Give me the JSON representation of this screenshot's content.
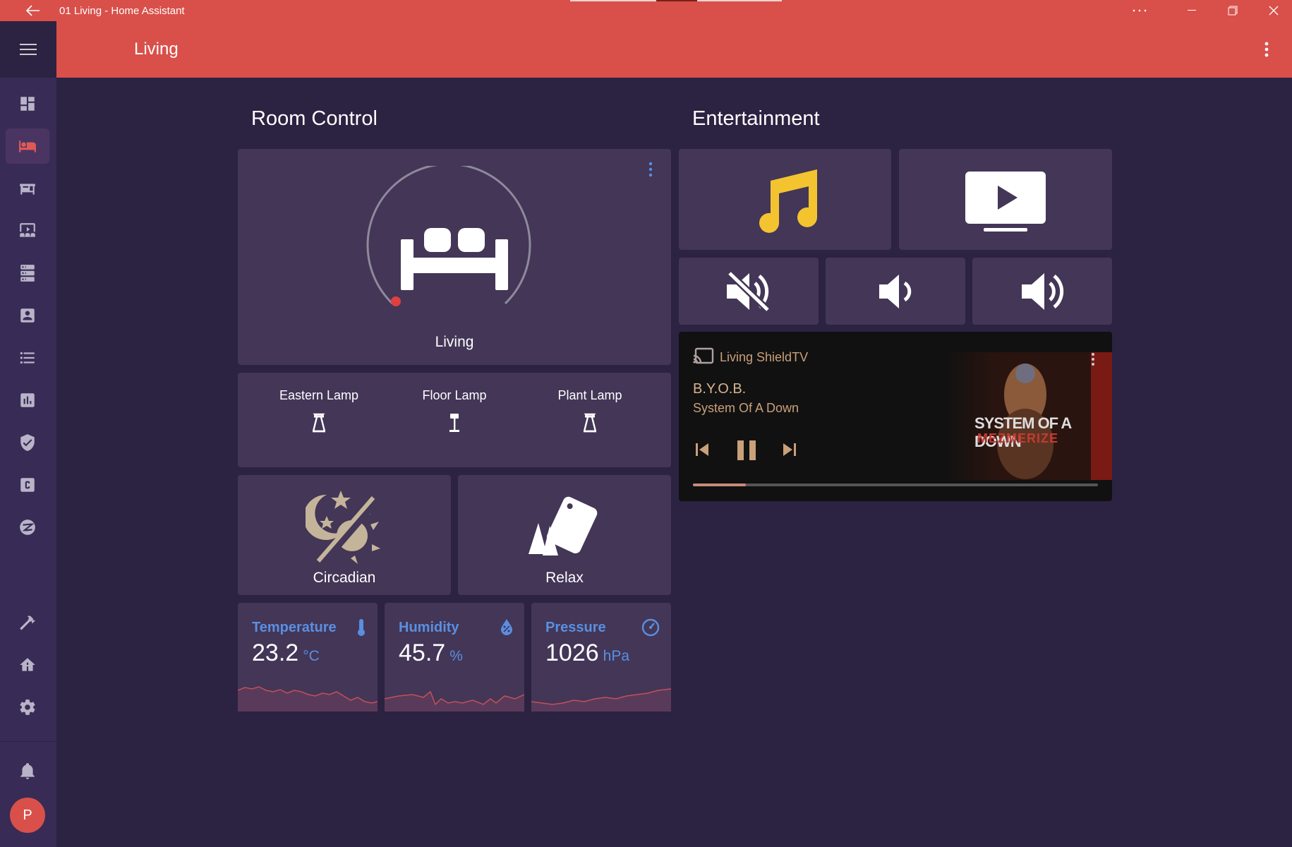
{
  "window": {
    "title": "01 Living - Home Assistant"
  },
  "header": {
    "title": "Living"
  },
  "sidebar": {
    "items": [
      {
        "icon": "view-dashboard-icon"
      },
      {
        "icon": "sofa-icon",
        "active": true
      },
      {
        "icon": "desk-icon"
      },
      {
        "icon": "theater-icon"
      },
      {
        "icon": "server-icon"
      },
      {
        "icon": "account-box-icon"
      },
      {
        "icon": "format-list-icon"
      },
      {
        "icon": "chart-bar-icon"
      },
      {
        "icon": "shield-check-icon"
      },
      {
        "icon": "alpha-c-box-icon"
      },
      {
        "icon": "zigbee-icon"
      }
    ],
    "bottom_items": [
      {
        "icon": "hammer-icon"
      },
      {
        "icon": "home-tree-icon"
      },
      {
        "icon": "cog-icon"
      }
    ],
    "avatar_initial": "P"
  },
  "room_control": {
    "title": "Room Control",
    "hero": {
      "label": "Living",
      "icon": "sofa-icon"
    },
    "lamps": [
      {
        "label": "Eastern Lamp",
        "icon": "lamp-icon"
      },
      {
        "label": "Floor Lamp",
        "icon": "floor-lamp-icon"
      },
      {
        "label": "Plant Lamp",
        "icon": "lamp-icon"
      }
    ],
    "scenes": [
      {
        "label": "Circadian",
        "icon": "theme-light-dark-icon"
      },
      {
        "label": "Relax",
        "icon": "cards-icon"
      }
    ],
    "sensors": [
      {
        "name": "Temperature",
        "value": "23.2",
        "unit": "°C",
        "icon": "thermometer-icon"
      },
      {
        "name": "Humidity",
        "value": "45.7",
        "unit": "%",
        "icon": "water-percent-icon"
      },
      {
        "name": "Pressure",
        "value": "1026",
        "unit": "hPa",
        "icon": "gauge-icon"
      }
    ]
  },
  "entertainment": {
    "title": "Entertainment",
    "media_player": {
      "source": "Living ShieldTV",
      "title": "B.Y.O.B.",
      "artist": "System Of A Down",
      "album_art_text_1": "SYSTEM OF A DOWN",
      "album_art_text_2": "MEZMERIZE",
      "progress": 0.13
    }
  },
  "colors": {
    "accent": "#d9504a",
    "background": "#2c2242",
    "card": "#433657",
    "sidebar": "#382b56",
    "sensor_text": "#5a8fe0",
    "music_icon": "#f4c430"
  }
}
